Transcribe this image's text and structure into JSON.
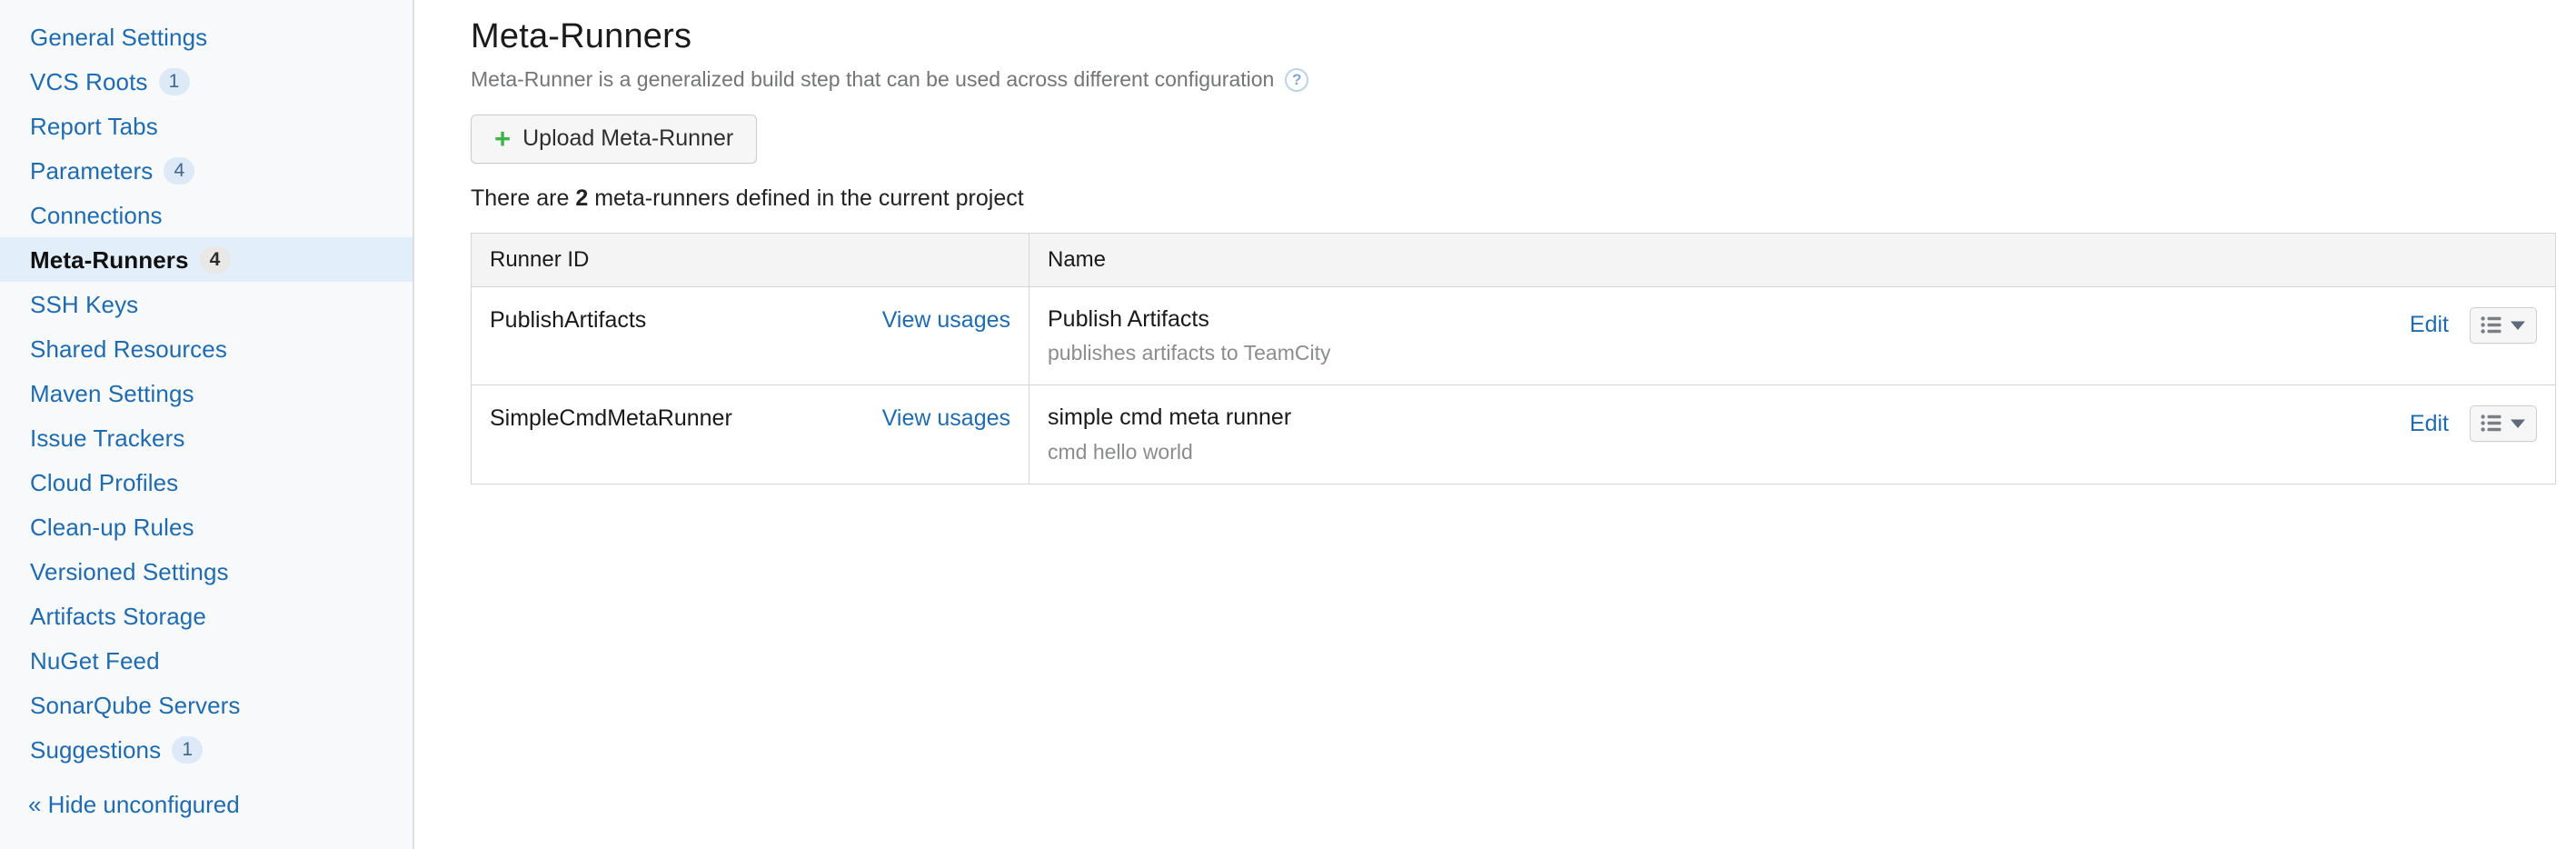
{
  "sidebar": {
    "items": [
      {
        "label": "General Settings",
        "badge": null,
        "active": false
      },
      {
        "label": "VCS Roots",
        "badge": "1",
        "active": false
      },
      {
        "label": "Report Tabs",
        "badge": null,
        "active": false
      },
      {
        "label": "Parameters",
        "badge": "4",
        "active": false
      },
      {
        "label": "Connections",
        "badge": null,
        "active": false
      },
      {
        "label": "Meta-Runners",
        "badge": "4",
        "active": true
      },
      {
        "label": "SSH Keys",
        "badge": null,
        "active": false
      },
      {
        "label": "Shared Resources",
        "badge": null,
        "active": false
      },
      {
        "label": "Maven Settings",
        "badge": null,
        "active": false
      },
      {
        "label": "Issue Trackers",
        "badge": null,
        "active": false
      },
      {
        "label": "Cloud Profiles",
        "badge": null,
        "active": false
      },
      {
        "label": "Clean-up Rules",
        "badge": null,
        "active": false
      },
      {
        "label": "Versioned Settings",
        "badge": null,
        "active": false
      },
      {
        "label": "Artifacts Storage",
        "badge": null,
        "active": false
      },
      {
        "label": "NuGet Feed",
        "badge": null,
        "active": false
      },
      {
        "label": "SonarQube Servers",
        "badge": null,
        "active": false
      },
      {
        "label": "Suggestions",
        "badge": "1",
        "active": false
      }
    ],
    "hide_unconfigured_label": "« Hide unconfigured"
  },
  "main": {
    "title": "Meta-Runners",
    "subtitle": "Meta-Runner is a generalized build step that can be used across different configuration",
    "help_icon": "question-mark-circle-icon",
    "upload_button": {
      "label": "Upload Meta-Runner",
      "plus_icon": "plus-icon"
    },
    "count_line": {
      "prefix": "There are ",
      "count": "2",
      "suffix": " meta-runners defined in the current project"
    },
    "table": {
      "columns": [
        "Runner ID",
        "Name"
      ],
      "view_usages_label": "View usages",
      "edit_label": "Edit",
      "menu_button": {
        "list_icon": "list-icon",
        "caret_icon": "caret-down-icon"
      },
      "rows": [
        {
          "runner_id": "PublishArtifacts",
          "name": "Publish Artifacts",
          "description": "publishes artifacts to TeamCity"
        },
        {
          "runner_id": "SimpleCmdMetaRunner",
          "name": "simple cmd meta runner",
          "description": "cmd hello world"
        }
      ]
    }
  },
  "colors": {
    "link": "#1f6bb0",
    "active_nav_bg": "#e2effb",
    "plus_green": "#3cb44a",
    "sidebar_bg": "#f8f9fa",
    "table_header_bg": "#f4f4f4",
    "muted_text": "#8a8c8e"
  }
}
